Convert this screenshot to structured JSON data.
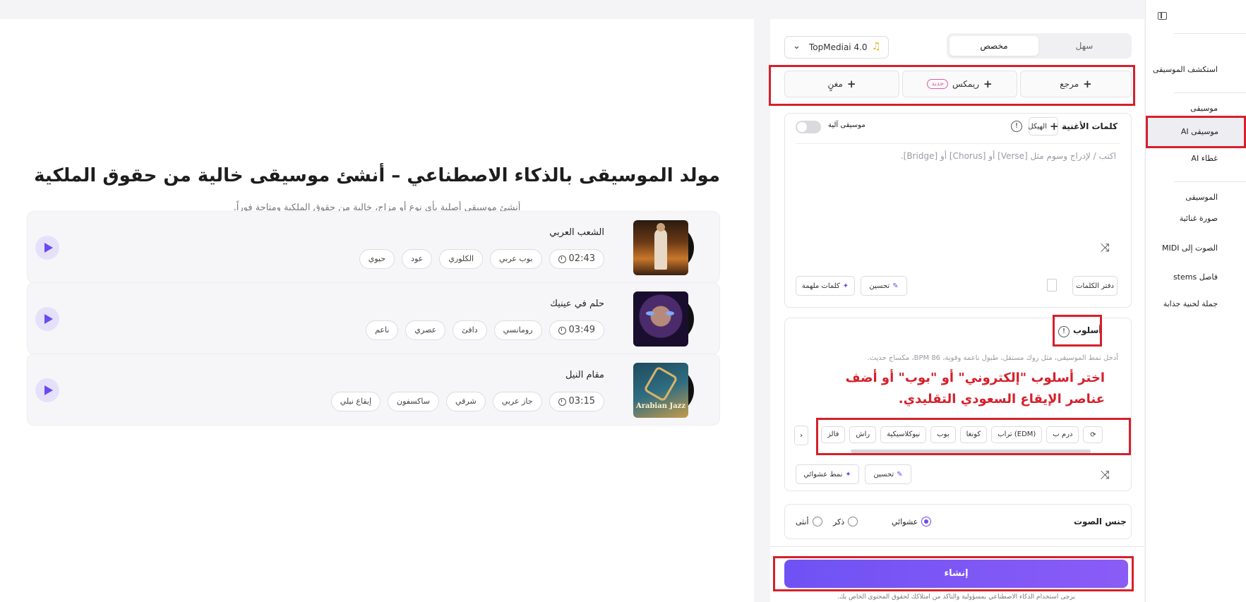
{
  "main": {
    "title": "مولد الموسيقى بالذكاء الاصطناعي – أنشئ موسيقى خالية من حقوق الملكية",
    "subtitle": "أنشئ موسيقى أصلية بأي نوع أو مزاج، خالية من حقوق الملكية ومتاحة فوراً.",
    "songs": [
      {
        "title": "الشعب العربي",
        "duration": "02:43",
        "tags": [
          "بوب عربي",
          "الكلوري",
          "عود",
          "حيوي"
        ]
      },
      {
        "title": "حلم في عينيك",
        "duration": "03:49",
        "tags": [
          "رومانسي",
          "دافئ",
          "عصري",
          "ناعم"
        ]
      },
      {
        "title": "مقام النيل",
        "duration": "03:15",
        "tags": [
          "جاز عربي",
          "شرقي",
          "ساكسفون",
          "إيقاع نيلي"
        ]
      }
    ],
    "cover3_text": "Arabian Jazz"
  },
  "panel": {
    "mode_tabs": [
      "سهل",
      "مخصص"
    ],
    "model": "TopMediai 4.0",
    "add_reference": "مرجع",
    "add_remix": "ريمكس",
    "new_badge": "جديد",
    "add_singer": "مغنٍ",
    "lyrics_label": "كلمات الأغنية",
    "structure_button": "الهيكل",
    "instrumental_label": "موسيقى آلية",
    "lyrics_placeholder": "اكتب / لإدراج وسوم مثل [Verse] أو [Chorus] أو [Bridge].",
    "lyrics_notebook": "دفتر الكلمات",
    "improve": "تحسين",
    "inspired_lyrics": "كلمات ملهمة",
    "style_label": "أسلوب",
    "style_placeholder": "أدخل نمط الموسيقى، مثل روك مستقل، طبول ناعمة وقوية، BPM 86، مكساج حديث.",
    "annotation_line1": "اختر أسلوب \"إلكتروني\" أو \"بوب\" أو أضف",
    "annotation_line2": "عناصر الإيقاع السعودي التقليدي.",
    "style_chips": [
      "درم ب",
      "تراب (EDM)",
      "كونغا",
      "بوب",
      "نيوكلاسيكية",
      "راش",
      "فالز"
    ],
    "random_style": "نمط عشوائي",
    "voice_label": "جنس الصوت",
    "voice_options": [
      "عشوائي",
      "ذكر",
      "أنثى"
    ],
    "generate": "إنشاء",
    "disclaimer": "يرجى استخدام الذكاء الاصطناعي بمسؤولية والتأكد من امتلاكك لحقوق المحتوى الخاص بك."
  },
  "sidebar": {
    "items": [
      "استكشف الموسيقى",
      "موسيقى",
      "موسيقى AI",
      "غطاء AI",
      "الموسيقى",
      "صورة غنائية",
      "الصوت إلى MIDI",
      "فاصل stems",
      "جملة لحنية جذابة"
    ]
  },
  "colors": {
    "accent": "#6c4af2",
    "annotation": "#d6202b"
  }
}
